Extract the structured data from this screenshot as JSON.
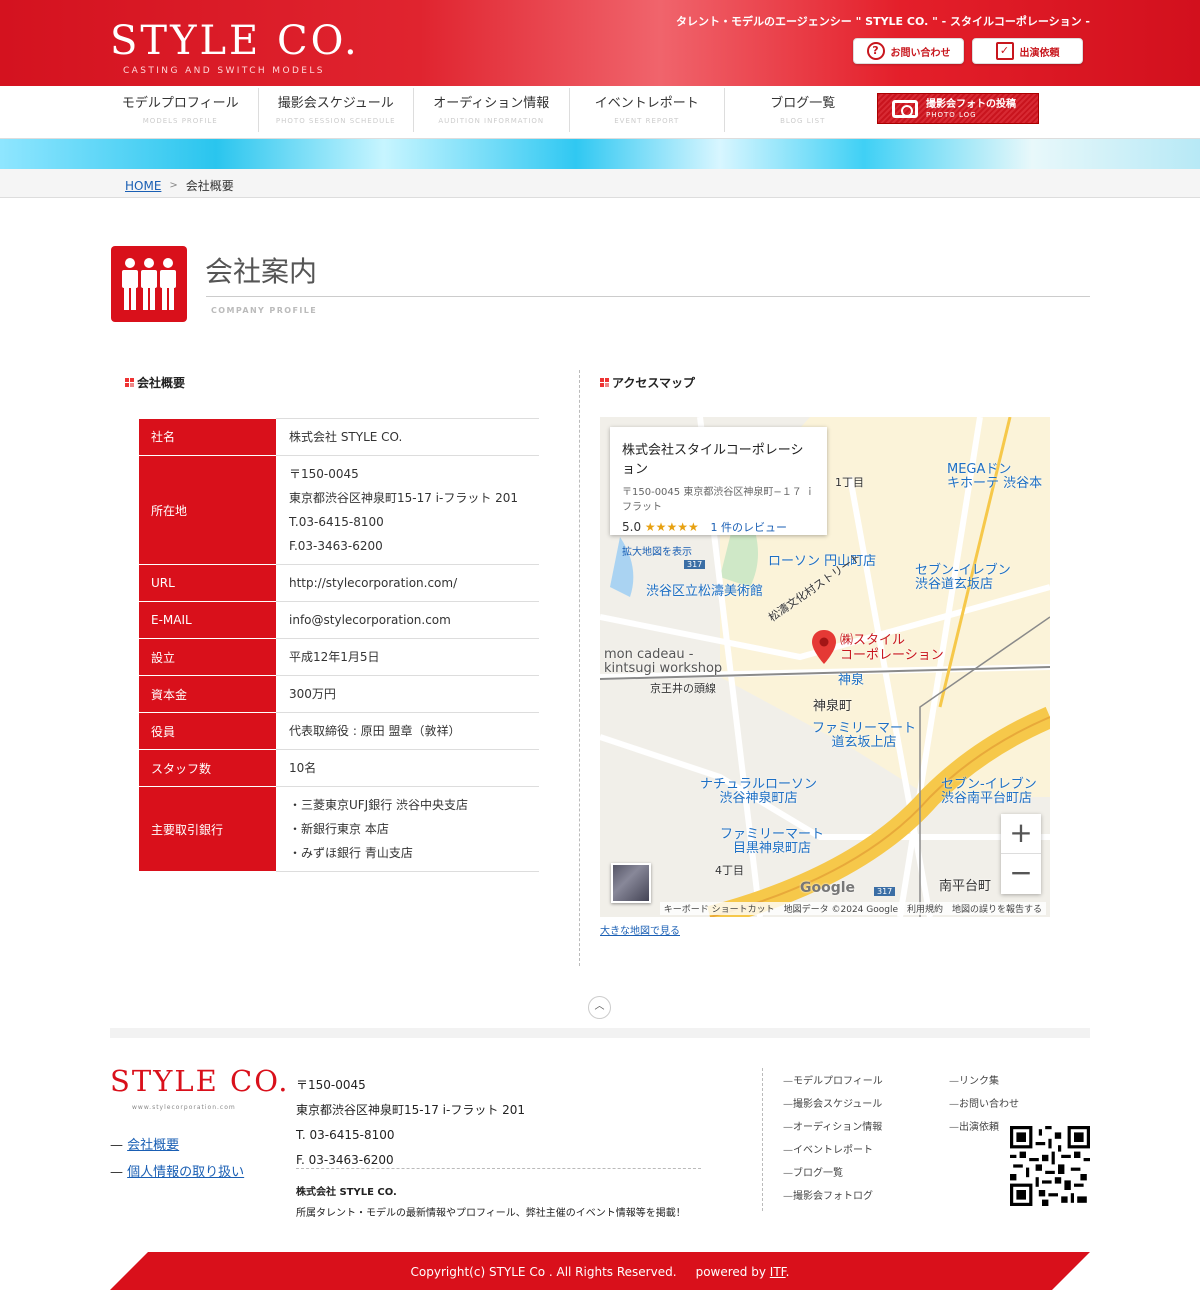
{
  "header": {
    "logo": "STYLE CO.",
    "logo_sub": "CASTING AND SWITCH MODELS",
    "tagline": "タレント・モデルのエージェンシー \" STYLE CO. \" - スタイルコーポレーション -",
    "contact_label": "お問い合わせ",
    "request_label": "出演依頼"
  },
  "nav": {
    "items": [
      {
        "ja": "モデルプロフィール",
        "en": "MODELS PROFILE"
      },
      {
        "ja": "撮影会スケジュール",
        "en": "PHOTO SESSION SCHEDULE"
      },
      {
        "ja": "オーディション情報",
        "en": "AUDITION INFORMATION"
      },
      {
        "ja": "イベントレポート",
        "en": "EVENT REPORT"
      },
      {
        "ja": "ブログ一覧",
        "en": "BLOG LIST"
      }
    ],
    "photo_log": {
      "ja": "撮影会フォトの投稿",
      "en": "PHOTO LOG"
    }
  },
  "breadcrumb": {
    "home": "HOME",
    "current": "会社概要"
  },
  "page": {
    "title": "会社案内",
    "title_en": "COMPANY PROFILE"
  },
  "overview": {
    "heading": "会社概要",
    "rows": {
      "name": {
        "label": "社名",
        "value": "株式会社 STYLE CO."
      },
      "address": {
        "label": "所在地",
        "zip": "〒150-0045",
        "addr": "東京都渋谷区神泉町15-17 i-フラット 201",
        "tel": "T.03-6415-8100",
        "fax": "F.03-3463-6200"
      },
      "url": {
        "label": "URL",
        "value": "http://stylecorporation.com/"
      },
      "email": {
        "label": "E-MAIL",
        "value": "info@stylecorporation.com"
      },
      "founded": {
        "label": "設立",
        "value": "平成12年1月5日"
      },
      "capital": {
        "label": "資本金",
        "value": "300万円"
      },
      "officer": {
        "label": "役員",
        "value": "代表取締役 : 原田 盟章（敦祥）"
      },
      "staff": {
        "label": "スタッフ数",
        "value": "10名"
      },
      "bank": {
        "label": "主要取引銀行",
        "b1": "・三菱東京UFJ銀行 渋谷中央支店",
        "b2": "・新銀行東京 本店",
        "b3": "・みずほ銀行 青山支店"
      }
    }
  },
  "access": {
    "heading": "アクセスマップ",
    "card": {
      "name": "株式会社スタイルコーポレーション",
      "addr": "〒150-0045 東京都渋谷区神泉町−１７ ｉフラット",
      "rating": "5.0",
      "stars": "★★★★★",
      "reviews": "1 件のレビュー",
      "link": "拡大地図を表示"
    },
    "labels": {
      "pin": "㈱スタイル\nコーポレーション",
      "shinsen_station": "神泉",
      "shinsencho": "神泉町",
      "lawson": "ローソン 円山町店",
      "seven1": "セブン-イレブン\n渋谷道玄坂店",
      "museum": "渋谷区立松濤美術館",
      "street": "松濤文化村ストリート",
      "mon": "mon cadeau -\nkintsugi workshop",
      "keio": "京王井の頭線",
      "family1": "ファミリーマート\n道玄坂上店",
      "natural": "ナチュラルローソン\n渋谷神泉町店",
      "seven2": "セブン-イレブン\n渋谷南平台町店",
      "family2": "ファミリーマート\n目黒神泉町店",
      "mega": "MEGAドン\nキホーテ 渋谷本",
      "chome1": "1丁目",
      "chome4": "4丁目",
      "nanpei": "南平台町",
      "road317": "317",
      "google": "Google",
      "attribution": "キーボード ショートカット　地図データ ©2024 Google　利用規約　地図の誤りを報告する"
    },
    "zoom_in": "+",
    "zoom_out": "−",
    "big_map": "大きな地図で見る"
  },
  "footer": {
    "logo": "STYLE CO.",
    "web": "www.stylecorporation.com",
    "links": [
      "会社概要",
      "個人情報の取り扱い"
    ],
    "zip": "〒150-0045",
    "addr": "東京都渋谷区神泉町15-17 i-フラット 201",
    "tel": "T. 03-6415-8100",
    "fax": "F. 03-3463-6200",
    "company": "株式会社 STYLE CO.",
    "desc": "所属タレント・モデルの最新情報やプロフィール、弊社主催のイベント情報等を掲載！",
    "nav1": [
      "モデルプロフィール",
      "撮影会スケジュール",
      "オーディション情報",
      "イベントレポート",
      "ブログ一覧",
      "撮影会フォトログ"
    ],
    "nav2": [
      "リンク集",
      "お問い合わせ",
      "出演依頼"
    ],
    "copyright": "Copyright(c) STYLE Co . All Rights Reserved.",
    "powered": "powered by",
    "powered_link": "ITF"
  }
}
